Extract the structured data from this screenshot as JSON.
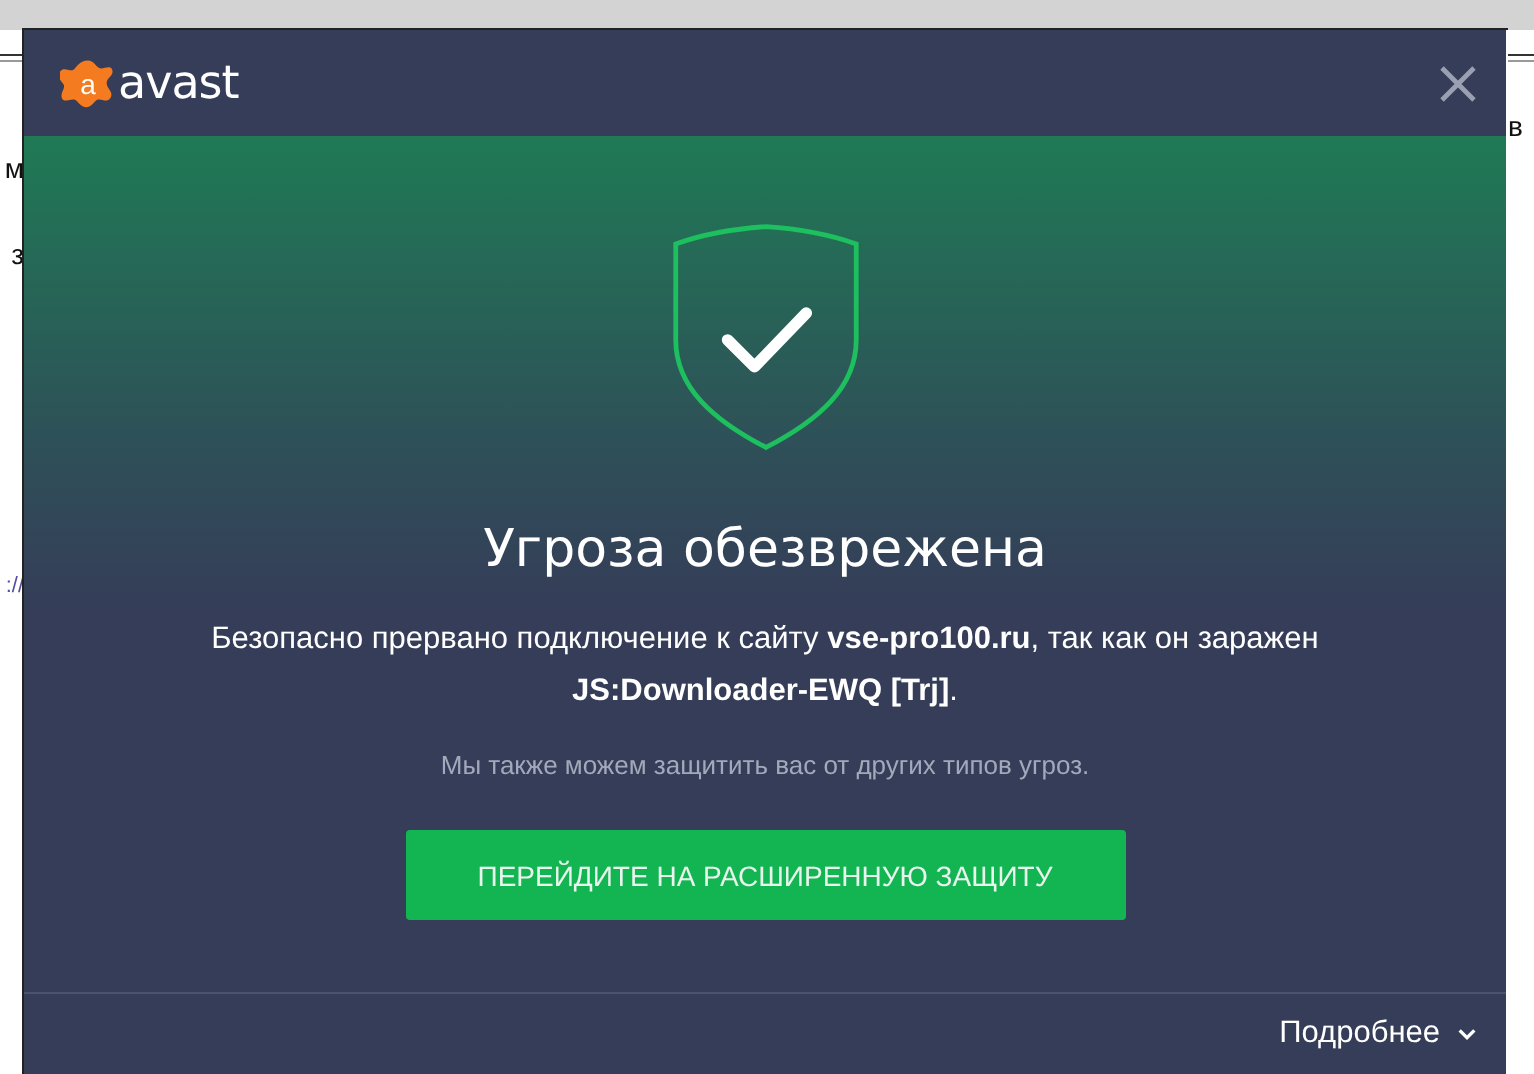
{
  "background_page": {
    "left_fragments": [
      {
        "text": "м",
        "kind": "plain"
      },
      {
        "text": "з",
        "kind": "plain"
      },
      {
        "text": "://",
        "kind": "link"
      }
    ],
    "right_fragments": [
      "в"
    ]
  },
  "dialog": {
    "logo": {
      "mark": "a",
      "name": "avast"
    },
    "title": "Угроза обезврежена",
    "message": "Безопасно прервано подключение к сайту **vse-pro100.ru**, так как он заражен **JS:Downloader-EWQ [Trj]**.",
    "note": "Мы также можем защитить вас от других типов угроз.",
    "button": "ПЕРЕЙДИТЕ НА РАСШИРЕННУЮ ЗАЩИТУ",
    "details": {
      "label": "Подробнее",
      "expanded": false
    }
  }
}
